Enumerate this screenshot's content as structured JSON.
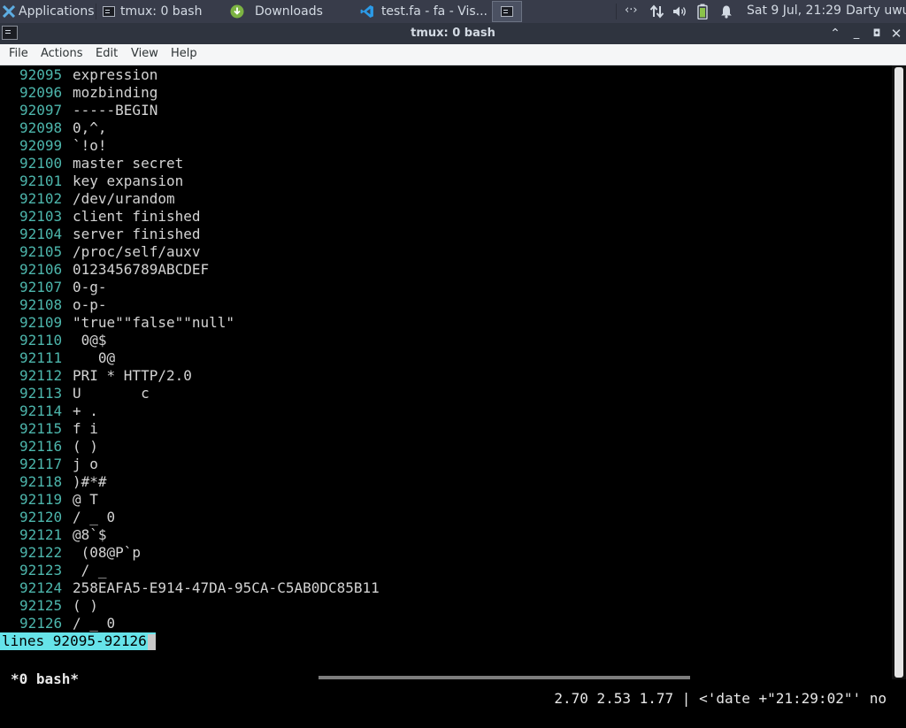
{
  "panel": {
    "apps_label": "Applications",
    "tasks": [
      {
        "label": "tmux: 0 bash",
        "icon": "terminal-icon"
      },
      {
        "label": "Downloads",
        "icon": "download-icon"
      },
      {
        "label": "test.fa - fa - Vis...",
        "icon": "vscode-icon"
      }
    ],
    "clock": "Sat  9 Jul, 21:29",
    "user": "Darty uwu"
  },
  "window": {
    "title": "tmux: 0 bash"
  },
  "menubar": {
    "items": [
      "File",
      "Actions",
      "Edit",
      "View",
      "Help"
    ]
  },
  "terminal": {
    "lines": [
      {
        "n": "92095",
        "t": "expression"
      },
      {
        "n": "92096",
        "t": "mozbinding"
      },
      {
        "n": "92097",
        "t": "-----BEGIN"
      },
      {
        "n": "92098",
        "t": "0,^,"
      },
      {
        "n": "92099",
        "t": "`!o!"
      },
      {
        "n": "92100",
        "t": "master secret"
      },
      {
        "n": "92101",
        "t": "key expansion"
      },
      {
        "n": "92102",
        "t": "/dev/urandom"
      },
      {
        "n": "92103",
        "t": "client finished"
      },
      {
        "n": "92104",
        "t": "server finished"
      },
      {
        "n": "92105",
        "t": "/proc/self/auxv"
      },
      {
        "n": "92106",
        "t": "0123456789ABCDEF"
      },
      {
        "n": "92107",
        "t": "0-g-"
      },
      {
        "n": "92108",
        "t": "o-p-"
      },
      {
        "n": "92109",
        "t": "\"true\"\"false\"\"null\""
      },
      {
        "n": "92110",
        "t": " 0@$"
      },
      {
        "n": "92111",
        "t": "   0@"
      },
      {
        "n": "92112",
        "t": "PRI * HTTP/2.0"
      },
      {
        "n": "92113",
        "t": "U       c"
      },
      {
        "n": "92114",
        "t": "+ ."
      },
      {
        "n": "92115",
        "t": "f i"
      },
      {
        "n": "92116",
        "t": "( )"
      },
      {
        "n": "92117",
        "t": "j o"
      },
      {
        "n": "92118",
        "t": ")#*#"
      },
      {
        "n": "92119",
        "t": "@ T"
      },
      {
        "n": "92120",
        "t": "/ _ 0"
      },
      {
        "n": "92121",
        "t": "@8`$"
      },
      {
        "n": "92122",
        "t": " (08@P`p"
      },
      {
        "n": "92123",
        "t": " / _"
      },
      {
        "n": "92124",
        "t": "258EAFA5-E914-47DA-95CA-C5AB0DC85B11"
      },
      {
        "n": "92125",
        "t": "( )"
      },
      {
        "n": "92126",
        "t": "/ _ 0"
      }
    ],
    "mode_line": "lines 92095-92126"
  },
  "tmux_status": {
    "window": "*0 bash*",
    "right": "2.70 2.53 1.77 | <'date +\"21:29:02\"' no"
  },
  "colors": {
    "accent": "#66e3e9",
    "line_number": "#4db6ac",
    "panel": "#383c4a"
  }
}
